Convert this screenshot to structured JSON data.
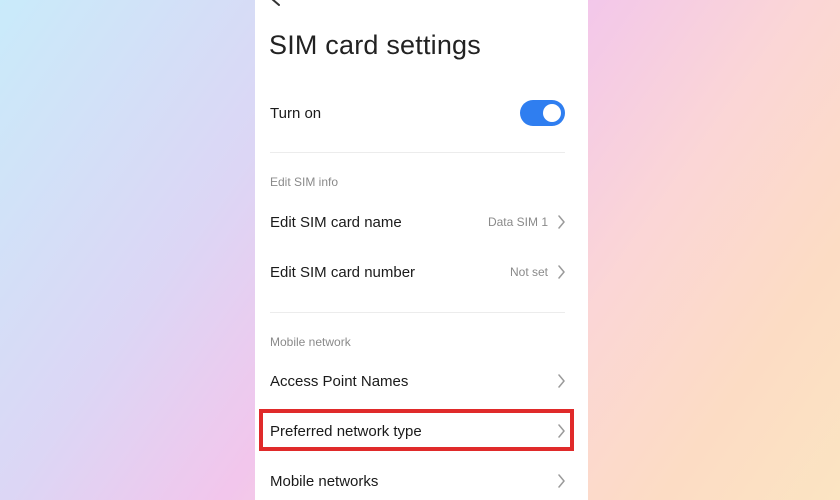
{
  "header": {
    "back_icon": "arrow-left-icon",
    "title": "SIM card settings"
  },
  "turn_on": {
    "label": "Turn on",
    "enabled": true,
    "accent_color": "#2f7ef0"
  },
  "sections": {
    "edit_sim_info": {
      "header": "Edit SIM info",
      "items": [
        {
          "label": "Edit SIM card name",
          "value": "Data SIM 1"
        },
        {
          "label": "Edit SIM card number",
          "value": "Not set"
        }
      ]
    },
    "mobile_network": {
      "header": "Mobile network",
      "items": [
        {
          "label": "Access Point Names"
        },
        {
          "label": "Preferred network type"
        },
        {
          "label": "Mobile networks"
        }
      ]
    }
  },
  "highlight": {
    "color": "#e02a2a"
  },
  "icons": {
    "chevron": "chevron-right-icon"
  }
}
